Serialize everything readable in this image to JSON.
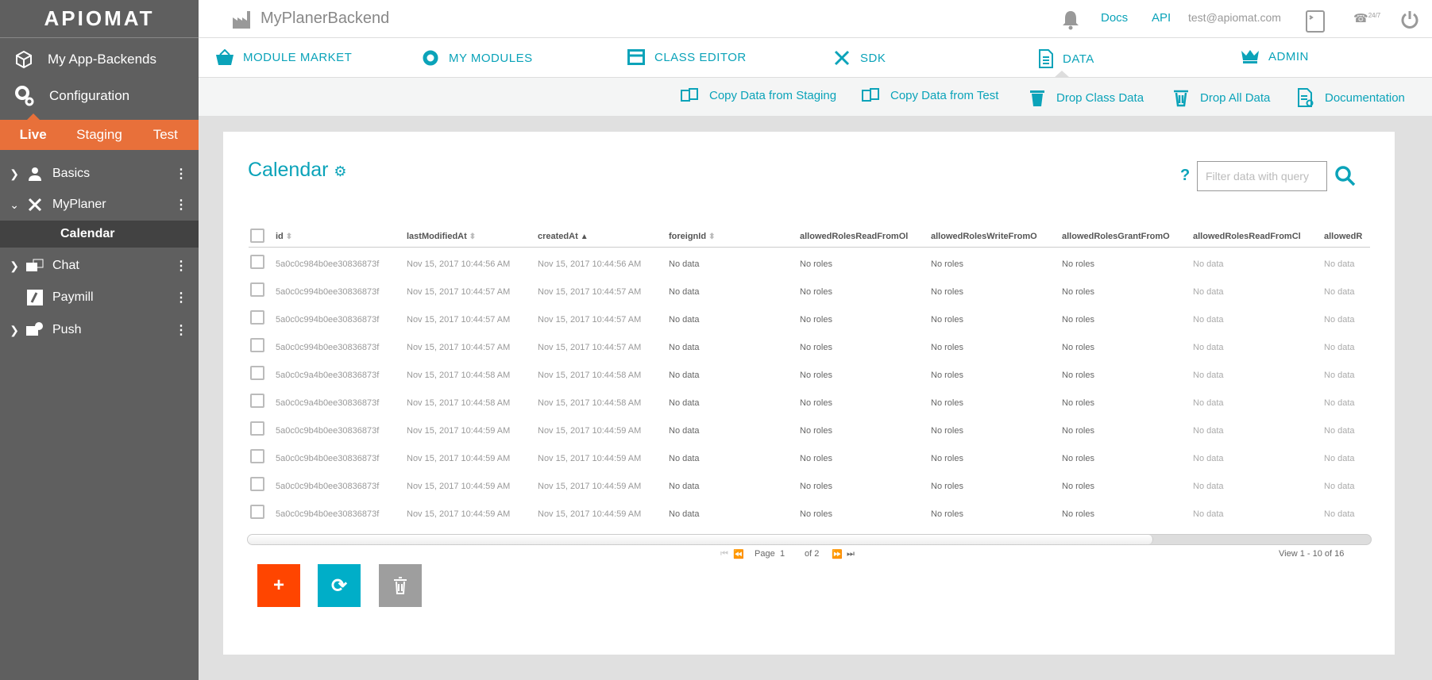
{
  "colors": {
    "accent": "#0ba3b9",
    "env": "#e8703a",
    "sidebar": "#5f5f5f",
    "selected": "#424242",
    "add": "#ff4500",
    "refresh": "#00aec8",
    "delete": "#9e9e9e"
  },
  "brand": "APIOMAT",
  "header": {
    "app_title": "MyPlanerBackend",
    "docs": "Docs",
    "api": "API",
    "email": "test@apiomat.com",
    "phone_badge": "24/7"
  },
  "sidebar": {
    "items": [
      {
        "label": "My App-Backends",
        "icon": "cube-icon"
      },
      {
        "label": "Configuration",
        "icon": "gears-icon"
      }
    ],
    "envs": [
      {
        "label": "Live",
        "active": true
      },
      {
        "label": "Staging"
      },
      {
        "label": "Test"
      }
    ],
    "tree": [
      {
        "label": "Basics",
        "icon": "user-icon",
        "expandable": true
      },
      {
        "label": "MyPlaner",
        "icon": "tools-icon",
        "expanded": true
      },
      {
        "label": "Calendar",
        "selected": true
      },
      {
        "label": "Chat",
        "icon": "chat-icon",
        "expandable": true
      },
      {
        "label": "Paymill",
        "icon": "paymill-icon"
      },
      {
        "label": "Push",
        "icon": "push-icon",
        "expandable": true
      }
    ]
  },
  "nav": [
    {
      "label": "MODULE MARKET",
      "icon": "basket-icon"
    },
    {
      "label": "MY MODULES",
      "icon": "gear-icon"
    },
    {
      "label": "CLASS EDITOR",
      "icon": "window-icon"
    },
    {
      "label": "SDK",
      "icon": "tools-icon"
    },
    {
      "label": "DATA",
      "icon": "document-icon",
      "active": true
    },
    {
      "label": "ADMIN",
      "icon": "crown-icon"
    }
  ],
  "toolbar": [
    {
      "label": "Copy Data from Staging",
      "icon": "copy-icon"
    },
    {
      "label": "Copy Data from Test",
      "icon": "copy-icon"
    },
    {
      "label": "Drop Class Data",
      "icon": "trash-class-icon"
    },
    {
      "label": "Drop All Data",
      "icon": "trash-icon"
    },
    {
      "label": "Documentation",
      "icon": "doc-icon"
    }
  ],
  "main": {
    "title": "Calendar",
    "help": "?",
    "filter_placeholder": "Filter data with query",
    "columns": [
      "id",
      "lastModifiedAt",
      "createdAt",
      "foreignId",
      "allowedRolesReadFromOl",
      "allowedRolesWriteFromO",
      "allowedRolesGrantFromO",
      "allowedRolesReadFromCl",
      "allowedR"
    ],
    "rows": [
      [
        "5a0c0c984b0ee30836873f",
        "Nov 15, 2017 10:44:56 AM",
        "Nov 15, 2017 10:44:56 AM",
        "No data",
        "No roles",
        "No roles",
        "No roles",
        "No data",
        "No data"
      ],
      [
        "5a0c0c994b0ee30836873f",
        "Nov 15, 2017 10:44:57 AM",
        "Nov 15, 2017 10:44:57 AM",
        "No data",
        "No roles",
        "No roles",
        "No roles",
        "No data",
        "No data"
      ],
      [
        "5a0c0c994b0ee30836873f",
        "Nov 15, 2017 10:44:57 AM",
        "Nov 15, 2017 10:44:57 AM",
        "No data",
        "No roles",
        "No roles",
        "No roles",
        "No data",
        "No data"
      ],
      [
        "5a0c0c994b0ee30836873f",
        "Nov 15, 2017 10:44:57 AM",
        "Nov 15, 2017 10:44:57 AM",
        "No data",
        "No roles",
        "No roles",
        "No roles",
        "No data",
        "No data"
      ],
      [
        "5a0c0c9a4b0ee30836873f",
        "Nov 15, 2017 10:44:58 AM",
        "Nov 15, 2017 10:44:58 AM",
        "No data",
        "No roles",
        "No roles",
        "No roles",
        "No data",
        "No data"
      ],
      [
        "5a0c0c9a4b0ee30836873f",
        "Nov 15, 2017 10:44:58 AM",
        "Nov 15, 2017 10:44:58 AM",
        "No data",
        "No roles",
        "No roles",
        "No roles",
        "No data",
        "No data"
      ],
      [
        "5a0c0c9b4b0ee30836873f",
        "Nov 15, 2017 10:44:59 AM",
        "Nov 15, 2017 10:44:59 AM",
        "No data",
        "No roles",
        "No roles",
        "No roles",
        "No data",
        "No data"
      ],
      [
        "5a0c0c9b4b0ee30836873f",
        "Nov 15, 2017 10:44:59 AM",
        "Nov 15, 2017 10:44:59 AM",
        "No data",
        "No roles",
        "No roles",
        "No roles",
        "No data",
        "No data"
      ],
      [
        "5a0c0c9b4b0ee30836873f",
        "Nov 15, 2017 10:44:59 AM",
        "Nov 15, 2017 10:44:59 AM",
        "No data",
        "No roles",
        "No roles",
        "No roles",
        "No data",
        "No data"
      ],
      [
        "5a0c0c9b4b0ee30836873f",
        "Nov 15, 2017 10:44:59 AM",
        "Nov 15, 2017 10:44:59 AM",
        "No data",
        "No roles",
        "No roles",
        "No roles",
        "No data",
        "No data"
      ]
    ],
    "pager": {
      "page_label": "Page",
      "page": "1",
      "of_label": "of 2",
      "view": "View 1 - 10 of 16"
    },
    "buttons": {
      "add": "+",
      "refresh": "⟳"
    }
  }
}
